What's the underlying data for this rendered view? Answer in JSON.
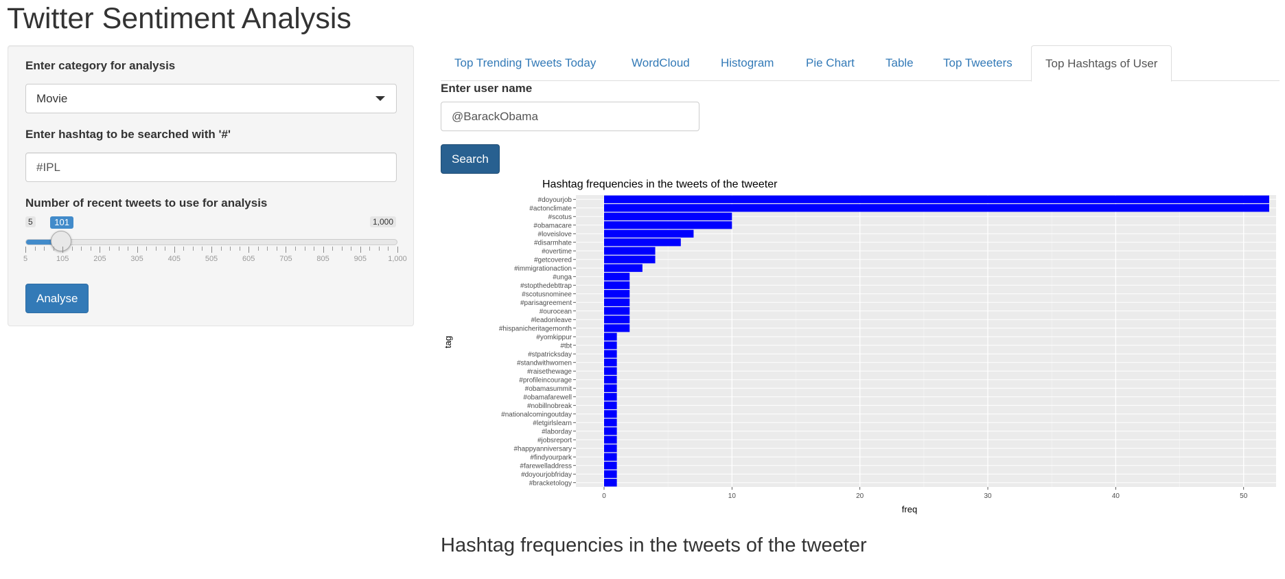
{
  "page": {
    "title": "Twitter Sentiment Analysis"
  },
  "sidebar": {
    "category_label": "Enter category for analysis",
    "category_value": "Movie",
    "hashtag_label": "Enter hashtag to be searched with '#'",
    "hashtag_value": "#IPL",
    "tweets_label": "Number of recent tweets to use for analysis",
    "slider": {
      "min_label": "5",
      "max_label": "1,000",
      "value_label": "101",
      "min": 5,
      "max": 1000,
      "value": 101,
      "tick_labels": [
        "5",
        "105",
        "205",
        "305",
        "405",
        "505",
        "605",
        "705",
        "805",
        "905",
        "1,000"
      ]
    },
    "analyse_label": "Analyse"
  },
  "tabs": [
    {
      "label": "Top Trending Tweets Today",
      "active": false
    },
    {
      "label": "WordCloud",
      "active": false
    },
    {
      "label": "Histogram",
      "active": false
    },
    {
      "label": "Pie Chart",
      "active": false
    },
    {
      "label": "Table",
      "active": false
    },
    {
      "label": "Top Tweeters",
      "active": false
    },
    {
      "label": "Top Hashtags of User",
      "active": true
    }
  ],
  "main": {
    "user_label": "Enter user name",
    "user_value": "@BarackObama",
    "search_label": "Search",
    "bottom_heading": "Hashtag frequencies in the tweets of the tweeter"
  },
  "colors": {
    "bar": "#0000ff",
    "panel_bg": "#ebebeb",
    "accent": "#337ab7"
  },
  "chart_data": {
    "type": "bar",
    "orientation": "horizontal",
    "title": "Hashtag frequencies in the tweets of the tweeter",
    "xlabel": "freq",
    "ylabel": "tag",
    "xlim": [
      0,
      55
    ],
    "xticks": [
      0,
      10,
      20,
      30,
      40,
      50
    ],
    "grid": true,
    "categories": [
      "#doyourjob",
      "#actonclimate",
      "#scotus",
      "#obamacare",
      "#loveislove",
      "#disarmhate",
      "#overtime",
      "#getcovered",
      "#immigrationaction",
      "#unga",
      "#stopthedebttrap",
      "#scotusnominee",
      "#parisagreement",
      "#ourocean",
      "#leadonleave",
      "#hispanicheritagemonth",
      "#yomkippur",
      "#tbt",
      "#stpatricksday",
      "#standwithwomen",
      "#raisethewage",
      "#profileincourage",
      "#obamasummit",
      "#obamafarewell",
      "#nobillnobreak",
      "#nationalcomingoutday",
      "#letgirlslearn",
      "#laborday",
      "#jobsreport",
      "#happyanniversary",
      "#findyourpark",
      "#farewelladdress",
      "#doyourjobfriday",
      "#bracketology"
    ],
    "values": [
      52,
      52,
      10,
      10,
      7,
      6,
      4,
      4,
      3,
      2,
      2,
      2,
      2,
      2,
      2,
      2,
      1,
      1,
      1,
      1,
      1,
      1,
      1,
      1,
      1,
      1,
      1,
      1,
      1,
      1,
      1,
      1,
      1,
      1
    ]
  }
}
